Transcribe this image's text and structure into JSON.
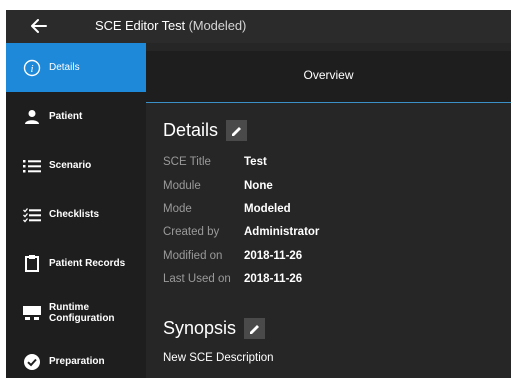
{
  "window": {
    "app_name": "SCE Editor",
    "sce_name": "Test",
    "status": "(Modeled)"
  },
  "sidebar": {
    "items": [
      {
        "label": "Details",
        "icon": "info-circle-icon",
        "active": true
      },
      {
        "label": "Patient",
        "icon": "person-icon"
      },
      {
        "label": "Scenario",
        "icon": "list-icon"
      },
      {
        "label": "Checklists",
        "icon": "checklist-icon"
      },
      {
        "label": "Patient Records",
        "icon": "clipboard-icon"
      },
      {
        "label": "Runtime Configuration",
        "icon": "runtime-config-icon"
      },
      {
        "label": "Preparation",
        "icon": "check-circle-icon"
      }
    ]
  },
  "main": {
    "tab": "Overview",
    "details_heading": "Details",
    "fields": [
      {
        "key": "SCE Title",
        "value": "Test"
      },
      {
        "key": "Module",
        "value": "None"
      },
      {
        "key": "Mode",
        "value": "Modeled"
      },
      {
        "key": "Created by",
        "value": "Administrator"
      },
      {
        "key": "Modified on",
        "value": "2018-11-26"
      },
      {
        "key": "Last Used on",
        "value": "2018-11-26"
      }
    ],
    "synopsis_heading": "Synopsis",
    "synopsis_text": "New SCE Description"
  },
  "colors": {
    "accent": "#1e88d9",
    "sidebar_bg": "#1e1e1e",
    "content_bg": "#262626",
    "title_bg": "#2b2b2b"
  }
}
